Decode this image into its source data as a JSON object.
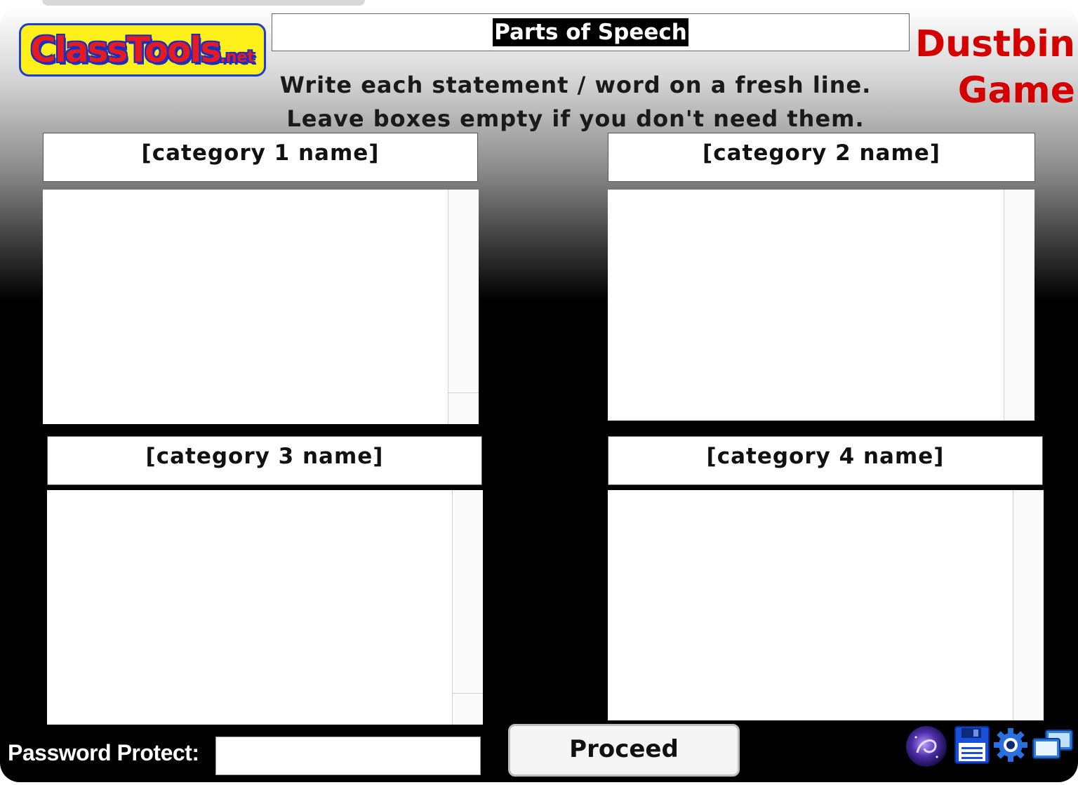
{
  "logo": {
    "text": "ClassTools",
    "suffix": ".net"
  },
  "title": "Parts of Speech",
  "instructions": {
    "line1": "Write each statement / word on a fresh line.",
    "line2": "Leave boxes empty if you don't need them."
  },
  "brand": {
    "line1": "Dustbin",
    "line2": "Game"
  },
  "categories": [
    {
      "header": "[category 1 name]",
      "content": ""
    },
    {
      "header": "[category 2 name]",
      "content": ""
    },
    {
      "header": "[category 3 name]",
      "content": ""
    },
    {
      "header": "[category 4 name]",
      "content": ""
    }
  ],
  "password": {
    "label": "Password Protect:",
    "value": ""
  },
  "proceed_label": "Proceed",
  "toolbar_icons": [
    "galaxy-icon",
    "save-icon",
    "settings-icon",
    "screens-icon"
  ],
  "colors": {
    "brand_red": "#d40000",
    "logo_yellow": "#ffef1a",
    "logo_blue": "#1c3fd2",
    "logo_red": "#e31b23"
  }
}
